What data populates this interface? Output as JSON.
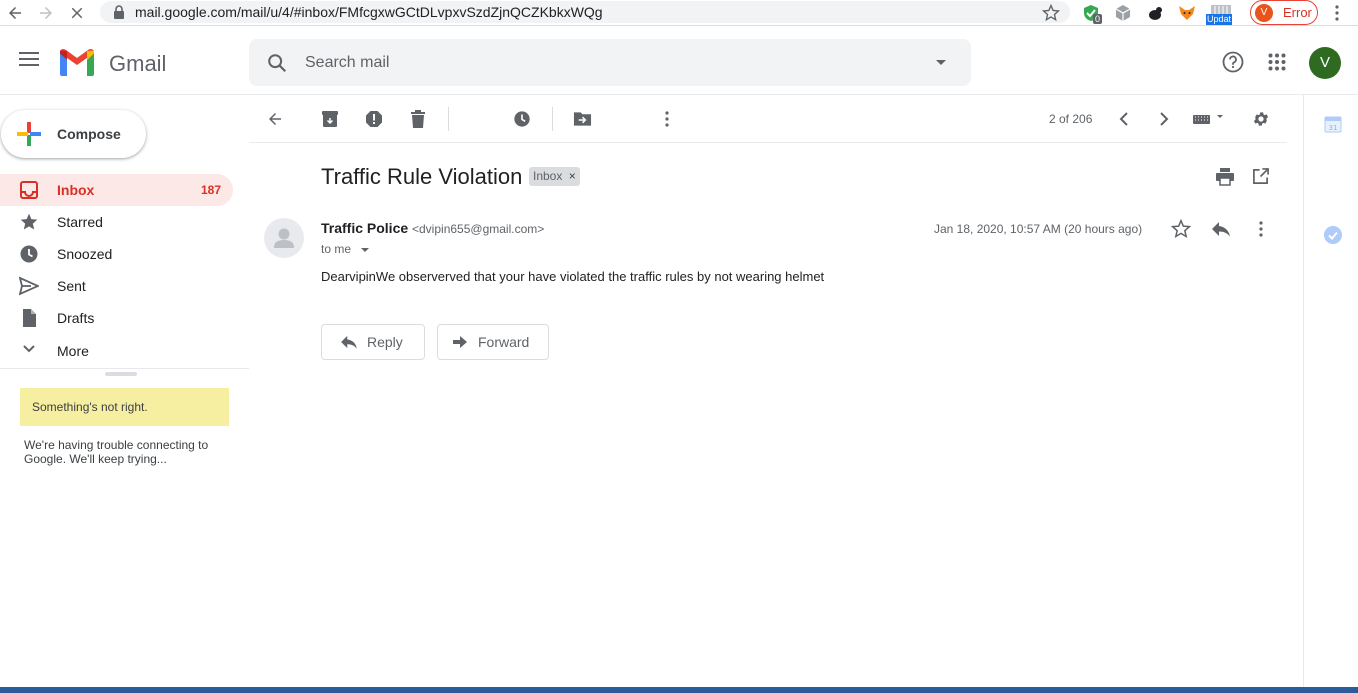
{
  "browser": {
    "url": "mail.google.com/mail/u/4/#inbox/FMfcgxwGCtDLvpxvSzdZjnQCZKbkxWQg",
    "profile_initial": "V",
    "profile_status": "Error",
    "ext_badge": "0",
    "ext_update": "Updat"
  },
  "header": {
    "app_name": "Gmail",
    "search_placeholder": "Search mail",
    "account_initial": "V"
  },
  "sidebar": {
    "compose_label": "Compose",
    "items": [
      {
        "label": "Inbox",
        "count": "187"
      },
      {
        "label": "Starred"
      },
      {
        "label": "Snoozed"
      },
      {
        "label": "Sent"
      },
      {
        "label": "Drafts"
      },
      {
        "label": "More"
      }
    ],
    "warning_title": "Something's not right.",
    "warning_message": "We're having trouble connecting to Google. We'll keep trying..."
  },
  "toolbar": {
    "page_count": "2 of 206"
  },
  "message": {
    "subject": "Traffic Rule Violation",
    "label": "Inbox",
    "sender_name": "Traffic Police",
    "sender_email": "<dvipin655@gmail.com>",
    "recipient": "to me",
    "date": "Jan 18, 2020, 10:57 AM (20 hours ago)",
    "body": "DearvipinWe observerved that your have violated the traffic rules by not wearing helmet",
    "reply_label": "Reply",
    "forward_label": "Forward"
  },
  "colors": {
    "accent_red": "#d93025",
    "inbox_active_bg": "#fce8e6",
    "warning_bg": "#f6eea0",
    "avatar_green": "#2e7d32"
  }
}
